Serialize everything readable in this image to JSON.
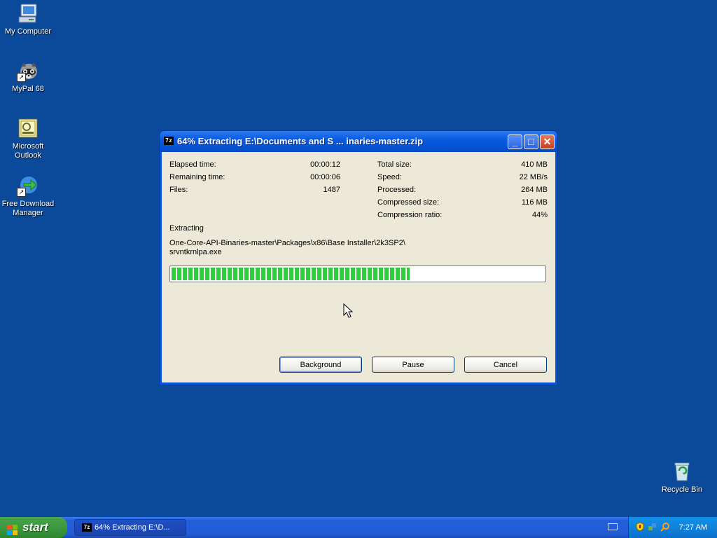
{
  "desktop": {
    "icons": [
      {
        "label": "My Computer",
        "icon": "my-computer-icon"
      },
      {
        "label": "MyPal 68",
        "icon": "raccoon-icon"
      },
      {
        "label": "Microsoft Outlook",
        "icon": "outlook-icon"
      },
      {
        "label": "Free Download Manager",
        "icon": "download-manager-icon"
      },
      {
        "label": "Recycle Bin",
        "icon": "recycle-bin-icon"
      }
    ]
  },
  "dialog": {
    "title_icon": "7z",
    "title": "64% Extracting E:\\Documents and S ... inaries-master.zip",
    "stats_left": [
      {
        "label": "Elapsed time:",
        "value": "00:00:12"
      },
      {
        "label": "Remaining time:",
        "value": "00:00:06"
      },
      {
        "label": "Files:",
        "value": "1487"
      }
    ],
    "stats_right": [
      {
        "label": "Total size:",
        "value": "410 MB"
      },
      {
        "label": "Speed:",
        "value": "22 MB/s"
      },
      {
        "label": "Processed:",
        "value": "264 MB"
      },
      {
        "label": "Compressed size:",
        "value": "116 MB"
      },
      {
        "label": "Compression ratio:",
        "value": "44%"
      }
    ],
    "status": "Extracting",
    "path_line1": "One-Core-API-Binaries-master\\Packages\\x86\\Base Installer\\2k3SP2\\",
    "path_line2": "srvntkrnlpa.exe",
    "progress_percent": 64,
    "buttons": {
      "background": "Background",
      "pause": "Pause",
      "cancel": "Cancel"
    }
  },
  "taskbar": {
    "start_label": "start",
    "task_icon": "7z",
    "task_label": "64% Extracting E:\\D...",
    "clock": "7:27 AM"
  },
  "colors": {
    "desktop": "#0b4a9a",
    "progress_fill": "#2fcd3a",
    "title_bar": "#0a5bdf"
  }
}
